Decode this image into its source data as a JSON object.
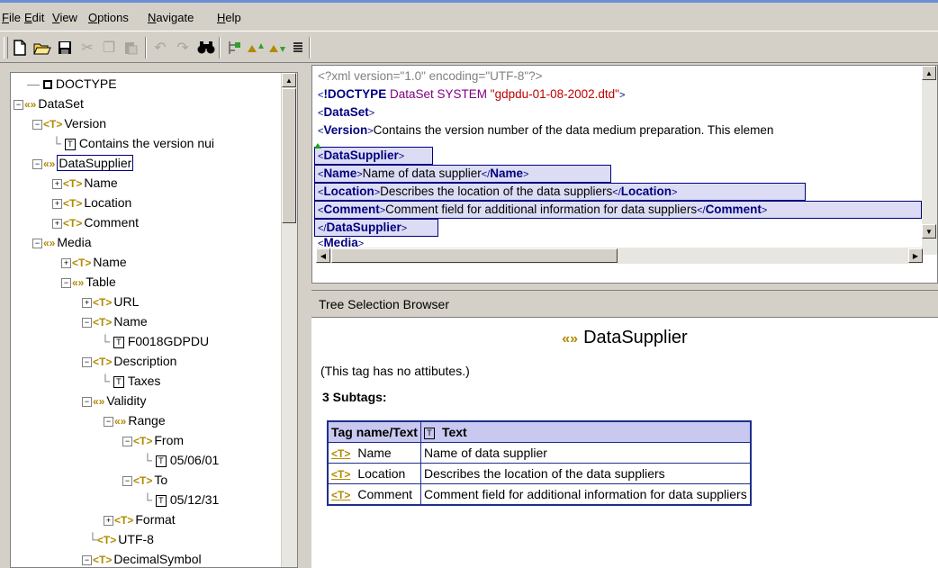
{
  "menu": [
    "File",
    "Edit",
    "View",
    "Options",
    "Navigate",
    "Help"
  ],
  "menu_underline": [
    "F",
    "E",
    "V",
    "O",
    "N",
    "H"
  ],
  "menu_rest": [
    "ile",
    "dit",
    "iew",
    "ptions",
    "avigate",
    "elp"
  ],
  "toolbar_icons": [
    "new-file-icon",
    "open-folder-icon",
    "save-icon",
    "cut-icon",
    "copy-icon",
    "paste-icon",
    "undo-icon",
    "redo-icon",
    "find-icon",
    "tree-icon",
    "move-up-icon",
    "move-down-icon",
    "list-icon"
  ],
  "tree": [
    {
      "label": "DOCTYPE",
      "type": "doc"
    },
    {
      "label": "DataSet",
      "type": "el"
    },
    {
      "label": "Version",
      "type": "t"
    },
    {
      "label": "Contains the version nui",
      "type": "txt"
    },
    {
      "label": "DataSupplier",
      "type": "el"
    },
    {
      "label": "Name",
      "type": "t"
    },
    {
      "label": "Location",
      "type": "t"
    },
    {
      "label": "Comment",
      "type": "t"
    },
    {
      "label": "Media",
      "type": "el"
    },
    {
      "label": "Name",
      "type": "t"
    },
    {
      "label": "Table",
      "type": "el"
    },
    {
      "label": "URL",
      "type": "t"
    },
    {
      "label": "Name",
      "type": "t"
    },
    {
      "label": "F0018GDPDU",
      "type": "txt"
    },
    {
      "label": "Description",
      "type": "t"
    },
    {
      "label": "Taxes",
      "type": "txt"
    },
    {
      "label": "Validity",
      "type": "el"
    },
    {
      "label": "Range",
      "type": "el"
    },
    {
      "label": "From",
      "type": "t"
    },
    {
      "label": "05/06/01",
      "type": "txt"
    },
    {
      "label": "To",
      "type": "t"
    },
    {
      "label": "05/12/31",
      "type": "txt"
    },
    {
      "label": "Format",
      "type": "t"
    },
    {
      "label": "UTF-8",
      "type": "t"
    },
    {
      "label": "DecimalSymbol",
      "type": "t"
    }
  ],
  "xml": {
    "pi": "<?xml version=\"1.0\" encoding=\"UTF-8\"?>",
    "doctype_kw": "!DOCTYPE",
    "doctype_name": "DataSet SYSTEM",
    "doctype_str": "\"gdpdu-01-08-2002.dtd\"",
    "dataset": "DataSet",
    "version_tag": "Version",
    "version_text": "Contains the version number of the data medium preparation. This elemen",
    "datasupplier": "DataSupplier",
    "name_tag": "Name",
    "name_text": "Name of data supplier",
    "location_tag": "Location",
    "location_text": "Describes the location of the data suppliers",
    "comment_tag": "Comment",
    "comment_text": "Comment field for additional information for data suppliers",
    "media": "Media"
  },
  "browser": {
    "header": "Tree Selection Browser",
    "title": "DataSupplier",
    "no_attr": "(This tag has no attibutes.)",
    "subtags": "3 Subtags:",
    "col1": "Tag name/Text",
    "col2": "Text",
    "rows": [
      {
        "name": "Name",
        "text": "Name of data supplier"
      },
      {
        "name": "Location",
        "text": "Describes the location of the data suppliers"
      },
      {
        "name": "Comment",
        "text": "Comment field for additional information for data suppliers"
      }
    ]
  }
}
